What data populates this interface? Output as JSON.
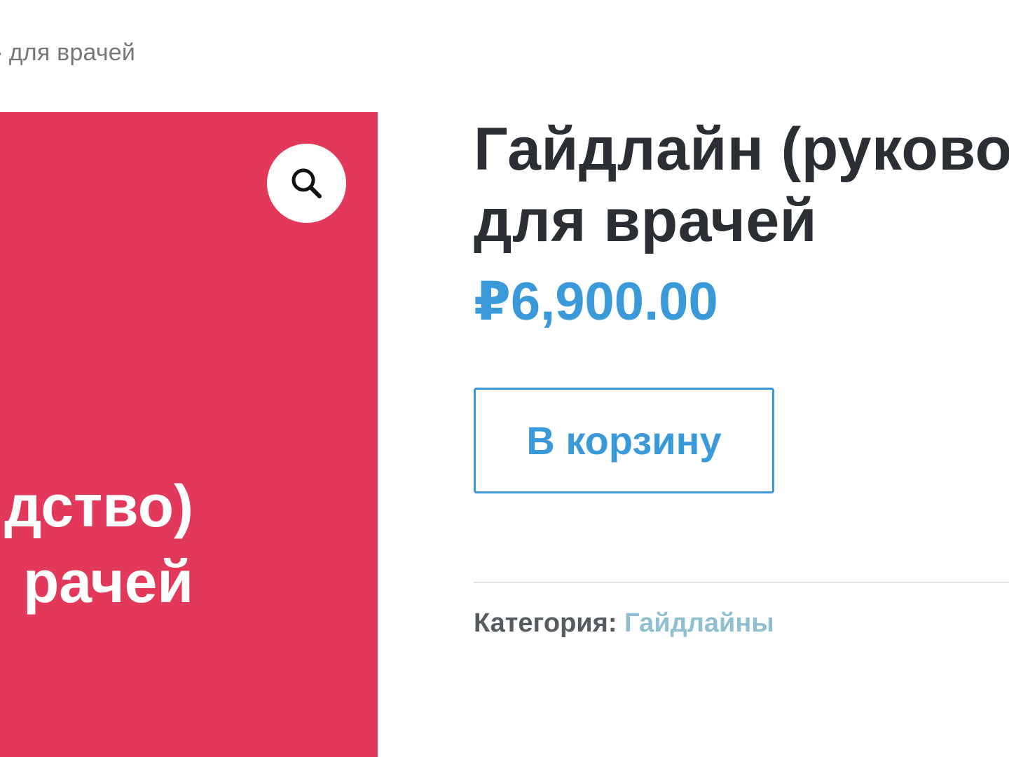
{
  "breadcrumb": {
    "current": "» для врачей"
  },
  "product_image": {
    "background_color": "#e2395b",
    "text_lines": [
      "дство)",
      "рачей"
    ],
    "zoom_icon": "magnifier-icon"
  },
  "product": {
    "title_lines": [
      "Гайдлайн (руково",
      "для врачей"
    ],
    "price": "₽6,900.00",
    "price_color": "#3a9ad9",
    "add_to_cart_label": "В корзину",
    "category_label": "Категория:",
    "category_value": "Гайдлайны"
  }
}
